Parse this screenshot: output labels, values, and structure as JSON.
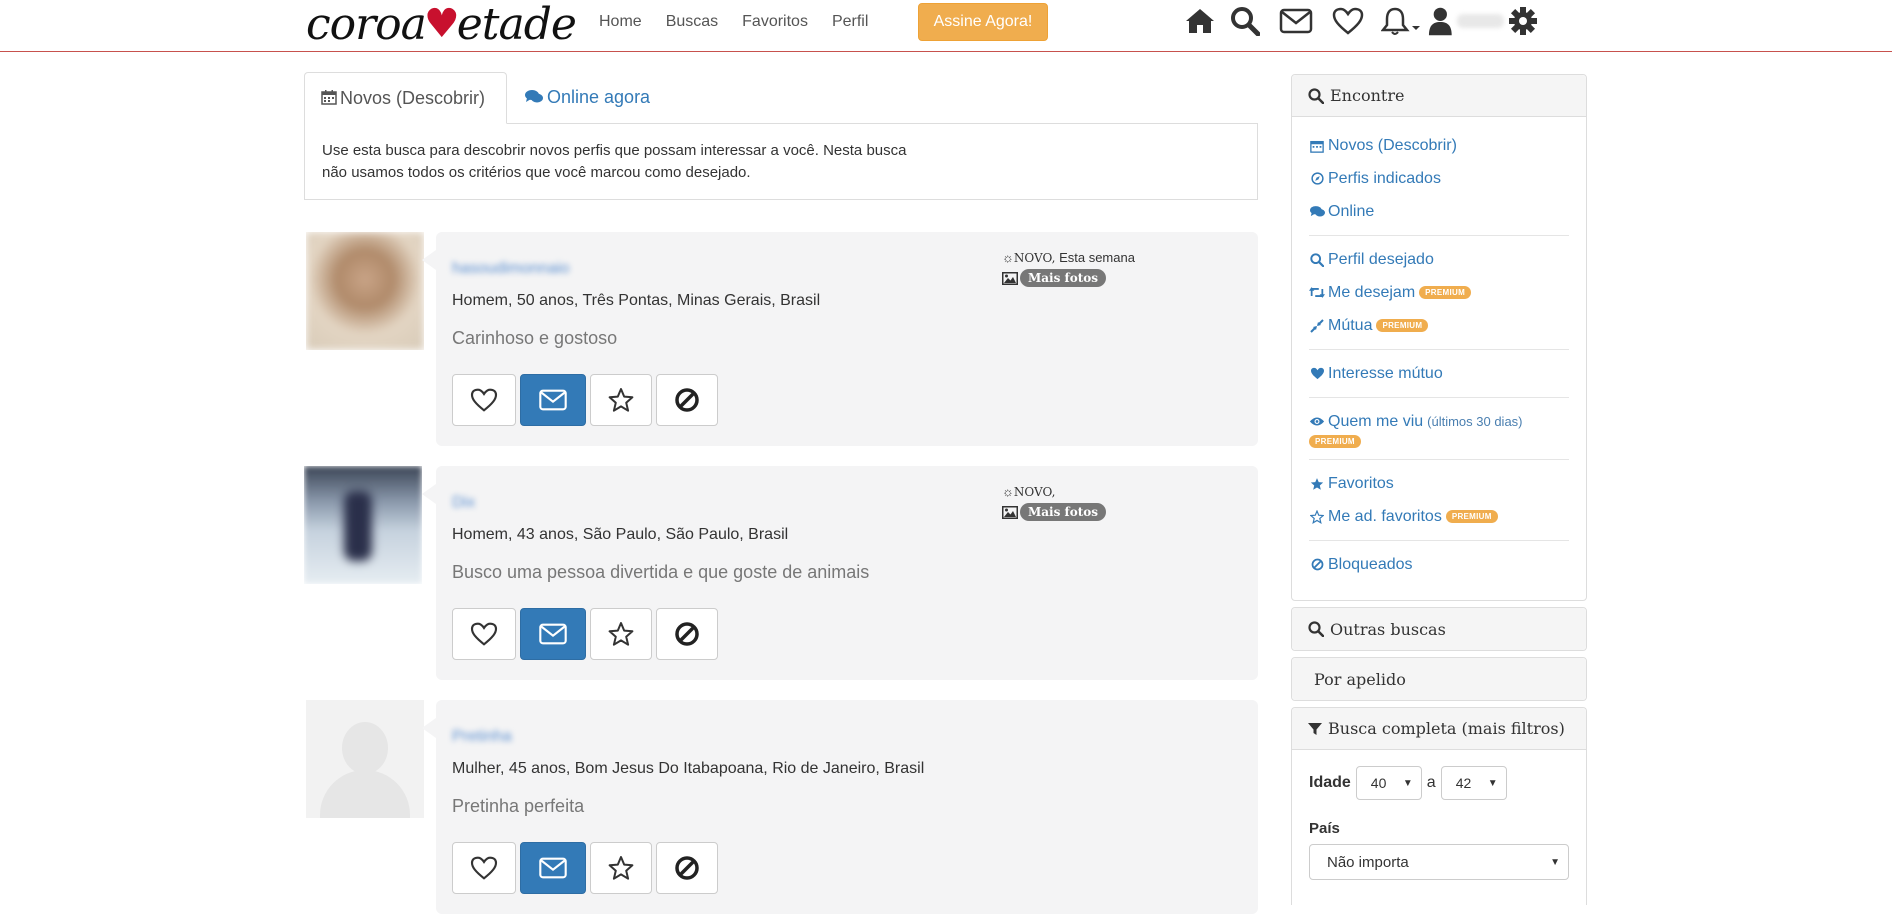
{
  "logo": {
    "left": "coroa",
    "right": "etade",
    "heart": "♥"
  },
  "nav": {
    "home": "Home",
    "buscas": "Buscas",
    "favoritos": "Favoritos",
    "perfil": "Perfil",
    "cta": "Assine Agora!"
  },
  "tabs": {
    "active": "Novos (Descobrir)",
    "inactive": "Online agora"
  },
  "tab_panel_text": "Use esta busca para descobrir novos perfis que possam interessar a você. Nesta busca não usamos todos os critérios que você marcou como desejado.",
  "profiles": [
    {
      "nick": "hasoudimonnaio",
      "info": "Homem, 50 anos, Três Pontas, Minas Gerais, Brasil",
      "headline": "Carinhoso e gostoso",
      "novo": "NOVO,",
      "when": "Esta semana",
      "fotos": "Mais fotos"
    },
    {
      "nick": "Dix",
      "info": "Homem, 43 anos, São Paulo, São Paulo, Brasil",
      "headline": "Busco uma pessoa divertida e que goste de animais",
      "novo": "NOVO,",
      "when": "",
      "fotos": "Mais fotos"
    },
    {
      "nick": "Pretinha",
      "info": "Mulher, 45 anos, Bom Jesus Do Itabapoana, Rio de Janeiro, Brasil",
      "headline": "Pretinha perfeita",
      "novo": "",
      "when": "",
      "fotos": ""
    }
  ],
  "sidebar": {
    "encontre": {
      "title": "Encontre",
      "novos": "Novos (Descobrir)",
      "indicados": "Perfis indicados",
      "online": "Online",
      "perfil_desejado": "Perfil desejado",
      "me_desejam": "Me desejam",
      "mutua": "Mútua",
      "interesse": "Interesse mútuo",
      "quem_viu": "Quem me viu",
      "quem_viu_sub": "(últimos 30 dias)",
      "favoritos": "Favoritos",
      "me_ad_fav": "Me ad. favoritos",
      "bloqueados": "Bloqueados",
      "premium": "PREMIUM"
    },
    "outras": "Outras buscas",
    "apelido": "Por apelido",
    "completa": "Busca completa (mais filtros)",
    "idade_label": "Idade",
    "idade_min": "40",
    "idade_sep": "a",
    "idade_max": "42",
    "pais_label": "País",
    "pais_value": "Não importa"
  },
  "colors": {
    "accent": "#337ab7",
    "cta": "#f0ad4e",
    "brand_line": "#c7514d",
    "heart": "#c8102e"
  }
}
